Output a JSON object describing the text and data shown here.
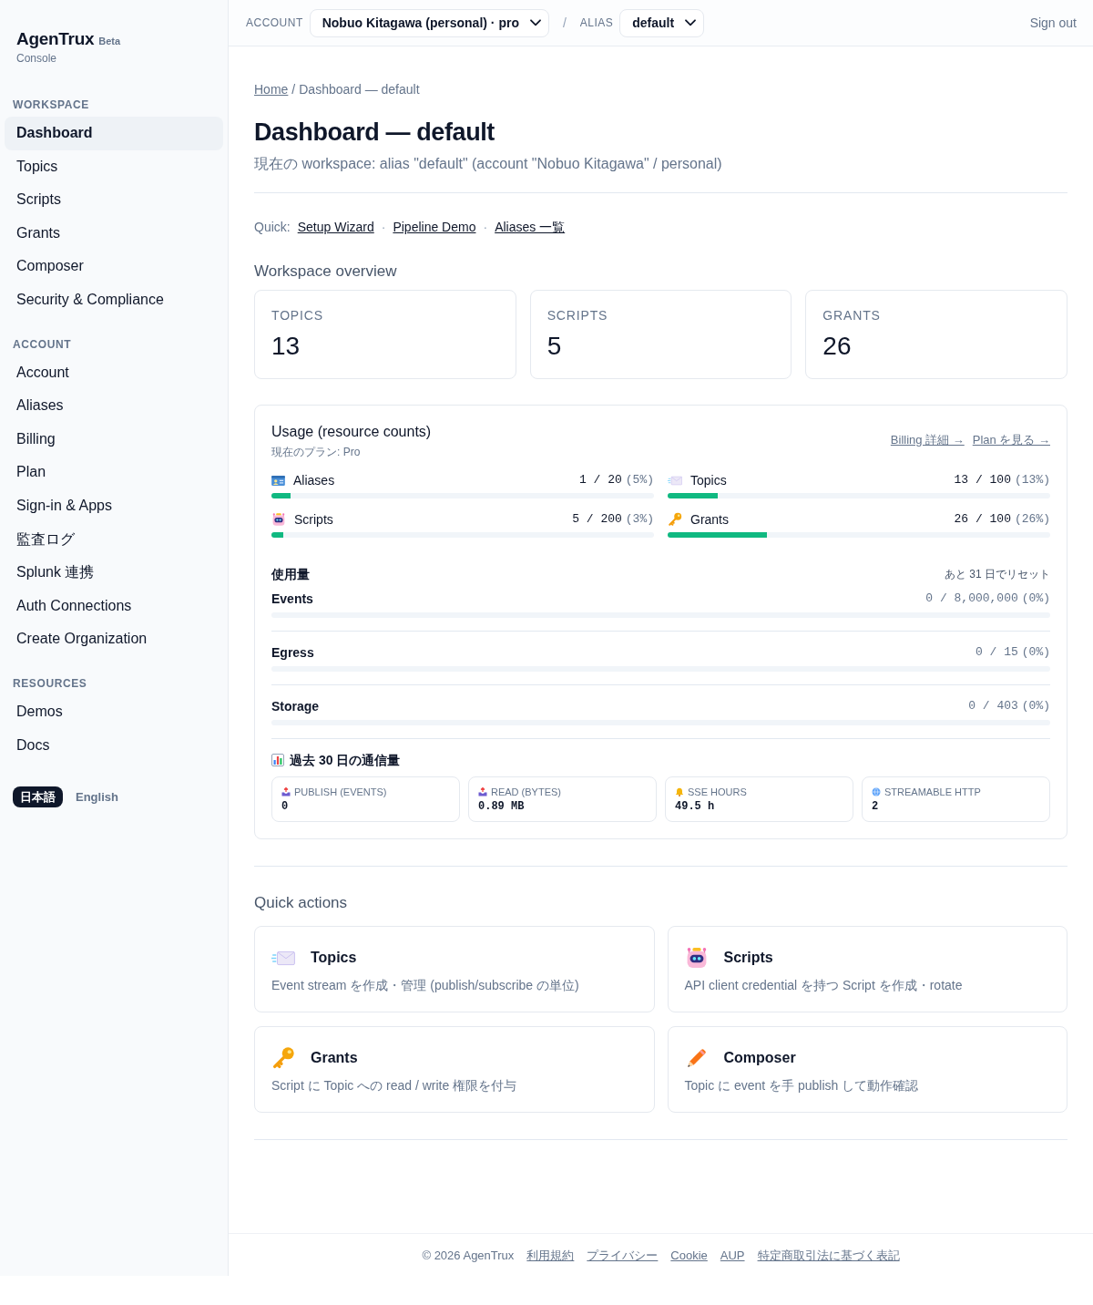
{
  "brand": {
    "name": "AgenTrux",
    "badge": "Beta",
    "subtitle": "Console"
  },
  "sidebar": {
    "sections": [
      {
        "heading": "WORKSPACE",
        "items": [
          {
            "label": "Dashboard",
            "selected": true
          },
          {
            "label": "Topics",
            "selected": false
          },
          {
            "label": "Scripts",
            "selected": false
          },
          {
            "label": "Grants",
            "selected": false
          },
          {
            "label": "Composer",
            "selected": false
          },
          {
            "label": "Security & Compliance",
            "selected": false
          }
        ]
      },
      {
        "heading": "ACCOUNT",
        "items": [
          {
            "label": "Account",
            "selected": false
          },
          {
            "label": "Aliases",
            "selected": false
          },
          {
            "label": "Billing",
            "selected": false
          },
          {
            "label": "Plan",
            "selected": false
          },
          {
            "label": "Sign-in & Apps",
            "selected": false
          },
          {
            "label": "監査ログ",
            "selected": false
          },
          {
            "label": "Splunk 連携",
            "selected": false
          },
          {
            "label": "Auth Connections",
            "selected": false
          },
          {
            "label": "Create Organization",
            "selected": false
          }
        ]
      },
      {
        "heading": "RESOURCES",
        "items": [
          {
            "label": "Demos",
            "selected": false
          },
          {
            "label": "Docs",
            "selected": false
          }
        ]
      }
    ],
    "languages": [
      {
        "label": "日本語",
        "selected": true
      },
      {
        "label": "English",
        "selected": false
      }
    ]
  },
  "topbar": {
    "account_label": "ACCOUNT",
    "account_value": "Nobuo Kitagawa (personal) · pro",
    "separator": "/",
    "alias_label": "ALIAS",
    "alias_value": "default",
    "sign_out": "Sign out"
  },
  "breadcrumb": {
    "link": "Home",
    "separator": "/",
    "current": "Dashboard — default"
  },
  "page": {
    "title": "Dashboard — default",
    "subtitle": "現在の workspace: alias \"default\" (account \"Nobuo Kitagawa\" / personal)"
  },
  "quick_links": {
    "label": "Quick:",
    "items": [
      {
        "kind": "link",
        "text": "Setup Wizard"
      },
      {
        "kind": "separator",
        "text": "·"
      },
      {
        "kind": "link",
        "text": "Pipeline Demo"
      },
      {
        "kind": "separator",
        "text": "·"
      },
      {
        "kind": "link",
        "text": "Aliases 一覧"
      }
    ]
  },
  "overview": {
    "title": "Workspace overview",
    "stats": [
      {
        "label": "TOPICS",
        "value": "13"
      },
      {
        "label": "SCRIPTS",
        "value": "5"
      },
      {
        "label": "GRANTS",
        "value": "26"
      }
    ]
  },
  "usage": {
    "title": "Usage (resource counts)",
    "plan": "現在のプラン: Pro",
    "links": [
      "Billing 詳細 →",
      "Plan を見る →"
    ],
    "resources": [
      {
        "name": "Aliases",
        "count": "1 / 20",
        "percent": "(5%)",
        "level": 0.05
      },
      {
        "name": "Topics",
        "count": "13 / 100",
        "percent": "(13%)",
        "level": 0.13
      },
      {
        "name": "Scripts",
        "count": "5 / 200",
        "percent": "(3%)",
        "level": 0.03
      },
      {
        "name": "Grants",
        "count": "26 / 100",
        "percent": "(26%)",
        "level": 0.26
      }
    ],
    "monthly": {
      "title": "使用量",
      "reset": "あと 31 日でリセット",
      "meters": [
        {
          "name": "Events",
          "count": "0 / 8,000,000",
          "percent": "(0%)",
          "level": 0
        },
        {
          "name": "Egress",
          "count": "0 / 15",
          "percent": "(0%)",
          "level": 0
        },
        {
          "name": "Storage",
          "count": "0 / 403",
          "percent": "(0%)",
          "level": 0
        }
      ]
    },
    "traffic": {
      "title": "過去 30 日の通信量",
      "tiles": [
        {
          "label": "PUBLISH (EVENTS)",
          "value": "0"
        },
        {
          "label": "READ (BYTES)",
          "value": "0.89 MB"
        },
        {
          "label": "SSE HOURS",
          "value": "49.5 h"
        },
        {
          "label": "STREAMABLE HTTP",
          "value": "2"
        }
      ]
    }
  },
  "quick_actions": {
    "title": "Quick actions",
    "cards": [
      {
        "title": "Topics",
        "description": "Event stream を作成・管理 (publish/subscribe の単位)"
      },
      {
        "title": "Scripts",
        "description": "API client credential を持つ Script を作成・rotate"
      },
      {
        "title": "Grants",
        "description": "Script に Topic への read / write 権限を付与"
      },
      {
        "title": "Composer",
        "description": "Topic に event を手 publish して動作確認"
      }
    ]
  },
  "footer": {
    "copyright": "© 2026 AgenTrux",
    "links": [
      "利用規約",
      "プライバシー",
      "Cookie",
      "AUP",
      "特定商取引法に基づく表記"
    ]
  }
}
